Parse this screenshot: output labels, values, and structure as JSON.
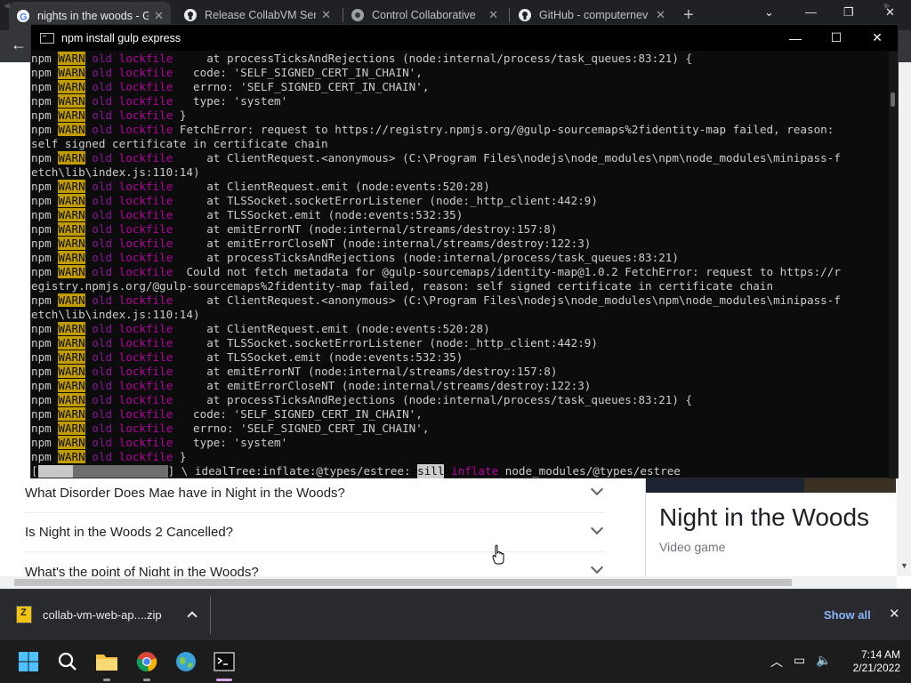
{
  "browser": {
    "tabs": [
      {
        "title": "nights in the woods - G",
        "active": true
      },
      {
        "title": "Release CollabVM Serv",
        "active": false
      },
      {
        "title": "Control Collaborative",
        "active": false
      },
      {
        "title": "GitHub - computernev",
        "active": false
      }
    ],
    "new_tab": "+",
    "window_controls": {
      "minimize": "—",
      "restore": "❐",
      "close": "✕"
    }
  },
  "console": {
    "title": "npm install gulp express",
    "controls": {
      "minimize": "—",
      "maximize": "☐",
      "close": "✕"
    },
    "lines": [
      {
        "w": true,
        "text": "     at processTicksAndRejections (node:internal/process/task_queues:83:21) {"
      },
      {
        "w": true,
        "text": "   code: 'SELF_SIGNED_CERT_IN_CHAIN',"
      },
      {
        "w": true,
        "text": "   errno: 'SELF_SIGNED_CERT_IN_CHAIN',"
      },
      {
        "w": true,
        "text": "   type: 'system'"
      },
      {
        "w": true,
        "text": " }"
      },
      {
        "w": true,
        "text": " FetchError: request to https://registry.npmjs.org/@gulp-sourcemaps%2fidentity-map failed, reason:"
      },
      {
        "w": false,
        "text": "self signed certificate in certificate chain"
      },
      {
        "w": true,
        "text": "     at ClientRequest.<anonymous> (C:\\Program Files\\nodejs\\node_modules\\npm\\node_modules\\minipass-f"
      },
      {
        "w": false,
        "text": "etch\\lib\\index.js:110:14)"
      },
      {
        "w": true,
        "text": "     at ClientRequest.emit (node:events:520:28)"
      },
      {
        "w": true,
        "text": "     at TLSSocket.socketErrorListener (node:_http_client:442:9)"
      },
      {
        "w": true,
        "text": "     at TLSSocket.emit (node:events:532:35)"
      },
      {
        "w": true,
        "text": "     at emitErrorNT (node:internal/streams/destroy:157:8)"
      },
      {
        "w": true,
        "text": "     at emitErrorCloseNT (node:internal/streams/destroy:122:3)"
      },
      {
        "w": true,
        "text": "     at processTicksAndRejections (node:internal/process/task_queues:83:21)"
      },
      {
        "w": true,
        "text": "  Could not fetch metadata for @gulp-sourcemaps/identity-map@1.0.2 FetchError: request to https://r"
      },
      {
        "w": false,
        "text": "egistry.npmjs.org/@gulp-sourcemaps%2fidentity-map failed, reason: self signed certificate in certificate chain"
      },
      {
        "w": true,
        "text": "     at ClientRequest.<anonymous> (C:\\Program Files\\nodejs\\node_modules\\npm\\node_modules\\minipass-f"
      },
      {
        "w": false,
        "text": "etch\\lib\\index.js:110:14)"
      },
      {
        "w": true,
        "text": "     at ClientRequest.emit (node:events:520:28)"
      },
      {
        "w": true,
        "text": "     at TLSSocket.socketErrorListener (node:_http_client:442:9)"
      },
      {
        "w": true,
        "text": "     at TLSSocket.emit (node:events:532:35)"
      },
      {
        "w": true,
        "text": "     at emitErrorNT (node:internal/streams/destroy:157:8)"
      },
      {
        "w": true,
        "text": "     at emitErrorCloseNT (node:internal/streams/destroy:122:3)"
      },
      {
        "w": true,
        "text": "     at processTicksAndRejections (node:internal/process/task_queues:83:21) {"
      },
      {
        "w": true,
        "text": "   code: 'SELF_SIGNED_CERT_IN_CHAIN',"
      },
      {
        "w": true,
        "text": "   errno: 'SELF_SIGNED_CERT_IN_CHAIN',"
      },
      {
        "w": true,
        "text": "   type: 'system'"
      },
      {
        "w": true,
        "text": " }"
      }
    ],
    "prefix": {
      "npm": "npm",
      "warn": "WARN",
      "old": "old",
      "lockfile": "lockfile"
    },
    "progress": {
      "open": "[",
      "close": "] \\ idealTree:inflate:@types/estree: ",
      "level": "sill",
      "action": "inflate",
      "target": " node_modules/@types/estree",
      "fraction": 0.27
    }
  },
  "page": {
    "questions": [
      "What Disorder Does Mae have in Night in the Woods?",
      "Is Night in the Woods 2 Cancelled?",
      "What's the point of Night in the Woods?"
    ],
    "knowledge_panel": {
      "title": "Night in the Woods",
      "subtitle": "Video game"
    }
  },
  "downloads": {
    "file": "collab-vm-web-ap....zip",
    "show_all": "Show all",
    "close": "✕"
  },
  "taskbar": {
    "time": "7:14 AM",
    "date": "2/21/2022",
    "tray_up": "︿"
  }
}
